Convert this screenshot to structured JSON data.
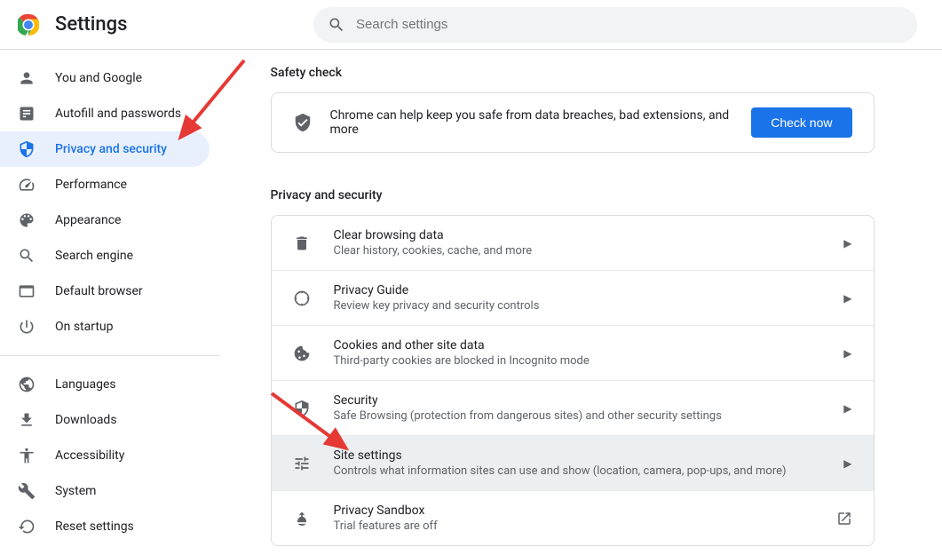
{
  "header": {
    "title": "Settings",
    "search_placeholder": "Search settings"
  },
  "sidebar": {
    "items": [
      {
        "label": "You and Google",
        "icon": "person"
      },
      {
        "label": "Autofill and passwords",
        "icon": "autofill"
      },
      {
        "label": "Privacy and security",
        "icon": "shield",
        "selected": true
      },
      {
        "label": "Performance",
        "icon": "speed"
      },
      {
        "label": "Appearance",
        "icon": "palette"
      },
      {
        "label": "Search engine",
        "icon": "search"
      },
      {
        "label": "Default browser",
        "icon": "browser"
      },
      {
        "label": "On startup",
        "icon": "power"
      }
    ],
    "items2": [
      {
        "label": "Languages",
        "icon": "globe"
      },
      {
        "label": "Downloads",
        "icon": "download"
      },
      {
        "label": "Accessibility",
        "icon": "accessibility"
      },
      {
        "label": "System",
        "icon": "wrench"
      },
      {
        "label": "Reset settings",
        "icon": "reset"
      }
    ]
  },
  "safety": {
    "header": "Safety check",
    "text": "Chrome can help keep you safe from data breaches, bad extensions, and more",
    "button": "Check now"
  },
  "privacy": {
    "header": "Privacy and security",
    "rows": [
      {
        "title": "Clear browsing data",
        "sub": "Clear history, cookies, cache, and more",
        "icon": "trash",
        "arrow": "chevron"
      },
      {
        "title": "Privacy Guide",
        "sub": "Review key privacy and security controls",
        "icon": "compass",
        "arrow": "chevron"
      },
      {
        "title": "Cookies and other site data",
        "sub": "Third-party cookies are blocked in Incognito mode",
        "icon": "cookie",
        "arrow": "chevron"
      },
      {
        "title": "Security",
        "sub": "Safe Browsing (protection from dangerous sites) and other security settings",
        "icon": "shield",
        "arrow": "chevron"
      },
      {
        "title": "Site settings",
        "sub": "Controls what information sites can use and show (location, camera, pop-ups, and more)",
        "icon": "tune",
        "arrow": "chevron",
        "hover": true
      },
      {
        "title": "Privacy Sandbox",
        "sub": "Trial features are off",
        "icon": "flask",
        "arrow": "external"
      }
    ]
  }
}
